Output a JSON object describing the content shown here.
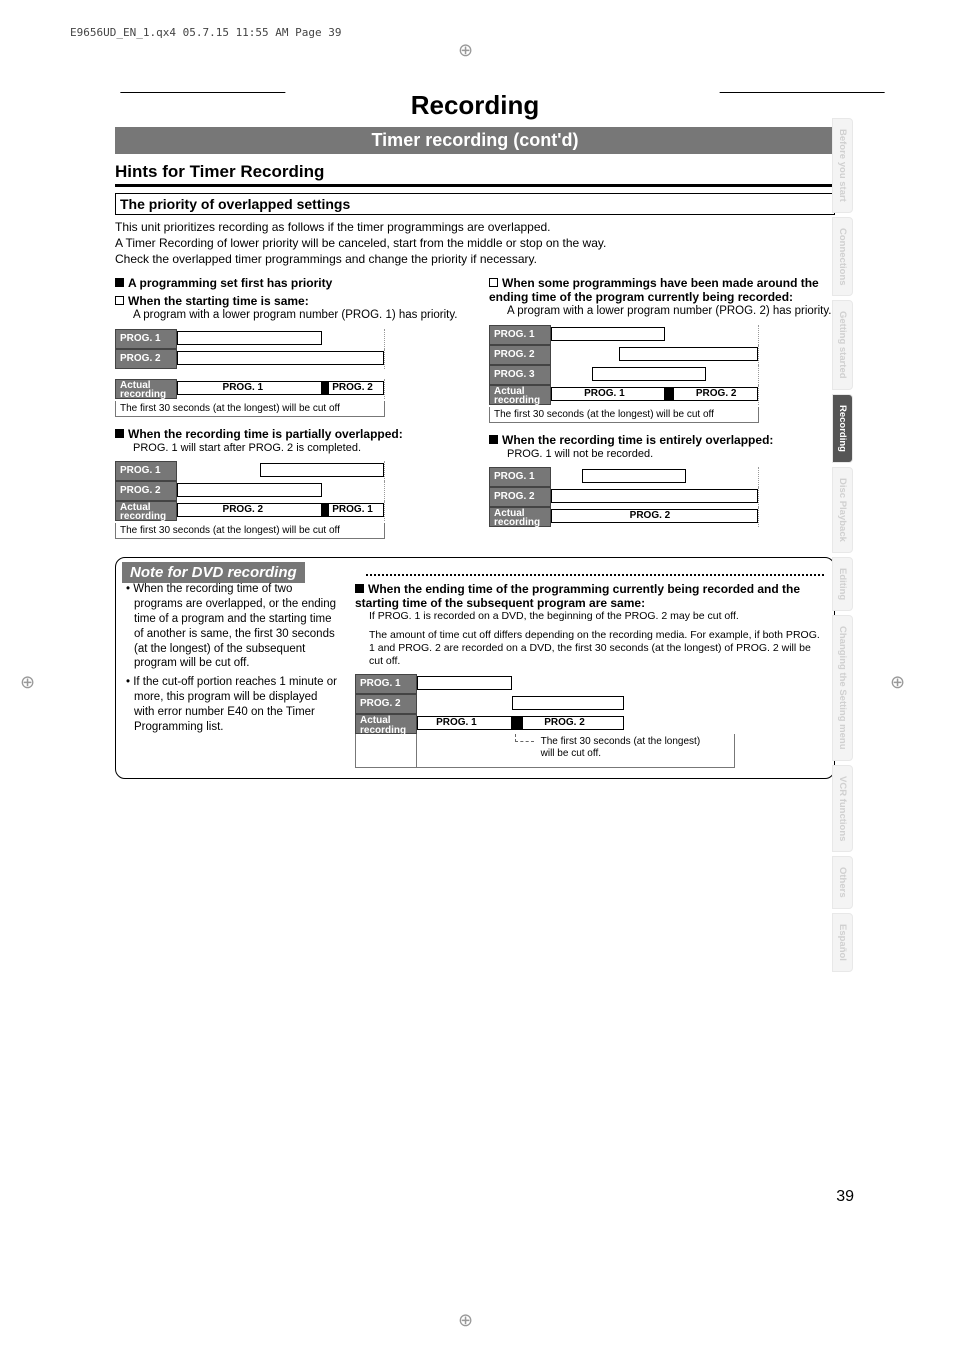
{
  "header_annot": "E9656UD_EN_1.qx4  05.7.15  11:55 AM  Page 39",
  "chapter_title": "Recording",
  "band_title": "Timer recording (cont'd)",
  "h2": "Hints for Timer Recording",
  "boxed": "The priority of overlapped settings",
  "intro_l1": "This unit prioritizes recording as follows if the timer programmings are overlapped.",
  "intro_l2": "A Timer Recording of lower priority will be canceled, start from the middle or stop on the way.",
  "intro_l3": "Check the overlapped timer programmings and change the priority if necessary.",
  "left": {
    "h1": "A programming set first has priority",
    "h1a": "When the starting time is same:",
    "h1a_d": "A program with a lower program number (PROG. 1) has priority.",
    "cut": "The first 30 seconds (at the longest) will be cut off",
    "h2": "When the recording time is partially overlapped:",
    "h2_d": "PROG. 1 will start after PROG. 2 is completed."
  },
  "right": {
    "h1": "When some programmings have been made around the ending time of the program currently being recorded:",
    "h1_d": "A program with a lower program number (PROG. 2) has priority.",
    "cut": "The first 30 seconds (at the longest) will be cut off",
    "h2": "When the recording time is entirely overlapped:",
    "h2_d": "PROG. 1 will not be recorded."
  },
  "labels": {
    "p1": "PROG. 1",
    "p2": "PROG. 2",
    "p3": "PROG. 3",
    "actual1": "Actual",
    "actual2": "recording"
  },
  "note": {
    "title": "Note for DVD recording",
    "b1": "• When the recording time of two programs are overlapped, or the ending time of a program and the starting time of another is same, the first 30 seconds (at the longest) of the subsequent program will be cut off.",
    "b2": "• If the cut-off portion reaches 1 minute or more, this program will be displayed with error number E40 on the Timer Programming list.",
    "rh": "When the ending time of the programming currently being recorded and the starting time of the subsequent program are same:",
    "rs1": "If PROG. 1 is recorded on a DVD, the beginning of the PROG. 2 may be cut off.",
    "rs2": "The amount of time cut off differs depending on the recording media. For example,  if both PROG. 1 and PROG. 2 are recorded on a DVD, the first 30 seconds (at the longest) of PROG. 2 will be cut off.",
    "anno": "The first 30 seconds (at the longest) will be cut off."
  },
  "tabs": [
    "Before you start",
    "Connections",
    "Getting started",
    "Recording",
    "Disc Playback",
    "Editing",
    "Changing the Setting menu",
    "VCR functions",
    "Others",
    "Español"
  ],
  "pageno": "39"
}
